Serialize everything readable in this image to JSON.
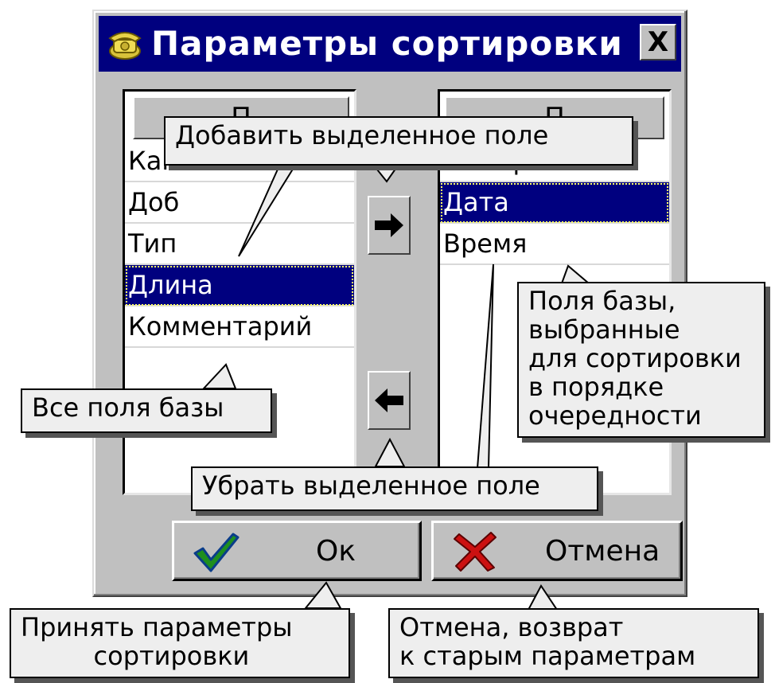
{
  "dialog": {
    "title": "Параметры сортировки",
    "close_label": "X",
    "ok_label": "Ок",
    "cancel_label": "Отмена"
  },
  "left_list": {
    "header": "П",
    "items": [
      "Канал",
      "Доб",
      "Тип",
      "Длина",
      "Комментарий"
    ],
    "selected": "Длина"
  },
  "right_list": {
    "header": "П",
    "items": [
      "Номер",
      "Дата",
      "Время"
    ],
    "selected": "Дата"
  },
  "callouts": {
    "add_field": "Добавить выделенное поле",
    "all_fields": "Все поля базы",
    "selected_fields": "Поля базы,\nвыбранные\nдля сортировки\nв порядке\nочередности",
    "remove_field": "Убрать выделенное поле",
    "accept": "Принять параметры\n         сортировки",
    "cancel": "Отмена, возврат\nк старым параметрам"
  },
  "colors": {
    "titlebar": "#00007f",
    "selection": "#00007f",
    "dialog_face": "#c0c0c0",
    "ok_check": "#1f8f1f",
    "cancel_x": "#cc1111"
  },
  "icons": {
    "title": "telephone-icon",
    "add": "arrow-right-icon",
    "remove": "arrow-left-icon",
    "ok": "checkmark-icon",
    "cancel": "red-x-icon"
  }
}
